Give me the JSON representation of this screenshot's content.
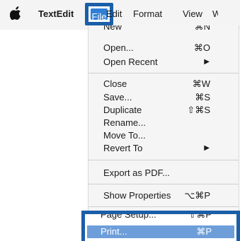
{
  "menubar": {
    "app_icon": "apple-icon",
    "app_name": "TextEdit",
    "items": [
      "File",
      "Edit",
      "Format",
      "View",
      "W"
    ]
  },
  "file_menu": {
    "items": [
      {
        "label": "New",
        "shortcut": "⌘N"
      },
      {
        "label": "Open...",
        "shortcut": "⌘O"
      },
      {
        "label": "Open Recent",
        "submenu_icon": "▶"
      },
      {
        "label": "Close",
        "shortcut": "⌘W"
      },
      {
        "label": "Save...",
        "shortcut": "⌘S"
      },
      {
        "label": "Duplicate",
        "shortcut": "⇧⌘S"
      },
      {
        "label": "Rename..."
      },
      {
        "label": "Move To..."
      },
      {
        "label": "Revert To",
        "submenu_icon": "▶"
      },
      {
        "label": "Export as PDF..."
      },
      {
        "label": "Show Properties",
        "shortcut": "⌥⌘P"
      },
      {
        "label": "Page Setup...",
        "shortcut": "⇧⌘P"
      },
      {
        "label": "Print...",
        "shortcut": "⌘P",
        "highlighted": true
      }
    ]
  },
  "colors": {
    "highlight_frame": "#1a5fa8",
    "selected_menu": "#2f7fd6",
    "print_row": "#6d9ed9"
  }
}
